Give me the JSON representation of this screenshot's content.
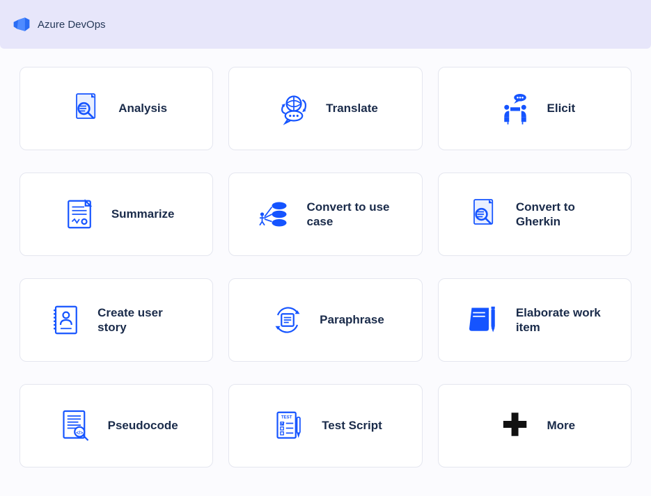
{
  "header": {
    "brand": "Azure DevOps"
  },
  "cards": [
    {
      "label": "Analysis",
      "icon": "analysis-icon"
    },
    {
      "label": "Translate",
      "icon": "translate-icon"
    },
    {
      "label": "Elicit",
      "icon": "elicit-icon"
    },
    {
      "label": "Summarize",
      "icon": "summarize-icon"
    },
    {
      "label": "Convert to use case",
      "icon": "usecase-icon"
    },
    {
      "label": "Convert to Gherkin",
      "icon": "gherkin-icon"
    },
    {
      "label": "Create user story",
      "icon": "userstory-icon"
    },
    {
      "label": "Paraphrase",
      "icon": "paraphrase-icon"
    },
    {
      "label": "Elaborate work item",
      "icon": "workitem-icon"
    },
    {
      "label": "Pseudocode",
      "icon": "pseudocode-icon"
    },
    {
      "label": "Test Script",
      "icon": "testscript-icon"
    },
    {
      "label": "More",
      "icon": "more-icon"
    }
  ],
  "colors": {
    "accent": "#1554ff",
    "header_bg": "#e7e6fa",
    "text": "#1a2b4a"
  }
}
